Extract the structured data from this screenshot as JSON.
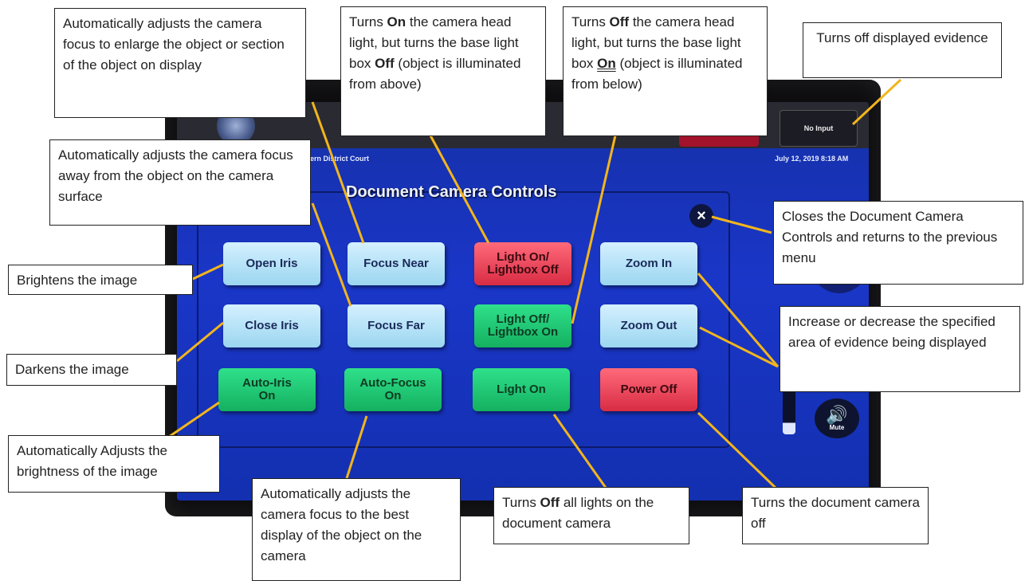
{
  "screen": {
    "court_label": "n Eastern District Court",
    "date_label": "July 12, 2019 8:18 AM",
    "no_input_label": "No Input",
    "panel_title": "Document Camera Controls",
    "close_icon": "×",
    "mute_label": "Mute",
    "speaker_icon": "🔊"
  },
  "buttons": {
    "open_iris": "Open Iris",
    "focus_near": "Focus Near",
    "light_on_lightbox_off": "Light On/\nLightbox Off",
    "zoom_in": "Zoom In",
    "close_iris": "Close Iris",
    "focus_far": "Focus Far",
    "light_off_lightbox_on": "Light Off/\nLightbox On",
    "zoom_out": "Zoom Out",
    "auto_iris_on": "Auto-Iris\nOn",
    "auto_focus_on": "Auto-Focus\nOn",
    "light_on": "Light On",
    "power_off": "Power Off"
  },
  "callouts": {
    "focus_near": "Automatically adjusts the camera focus to enlarge the object or section of the object on display",
    "light_on": {
      "pre": "Turns ",
      "bold": "On",
      "post1": " the camera head light, but turns the base light box ",
      "bold2": "Off",
      "post2": " (object is illuminated from above)"
    },
    "light_off": {
      "pre": "Turns ",
      "bold": "Off",
      "post1": " the camera head light, but turns the base light box ",
      "bold2": "On",
      "post2": " (object is illuminated from below)"
    },
    "no_input": "Turns off displayed evidence",
    "focus_far": "Automatically adjusts the camera focus away from the object on the camera surface",
    "close": "Closes the Document Camera Controls and returns to the previous menu",
    "open_iris": "Brightens the image",
    "zoom": "Increase or decrease the specified area of evidence being displayed",
    "close_iris": "Darkens the image",
    "auto_iris": "Automatically Adjusts the brightness of the image",
    "auto_focus": "Automatically adjusts the camera focus to the best display of the object on the camera",
    "lights_off": {
      "pre": "Turns ",
      "bold": "Off",
      "post": " all lights on the document camera"
    },
    "power_off": "Turns the document camera off"
  },
  "colors": {
    "connector": "#f2b51c",
    "screen_blue": "#1a36c8",
    "btn_green": "#1fc872",
    "btn_red": "#e23a50",
    "btn_blue": "#b7e3f7"
  }
}
